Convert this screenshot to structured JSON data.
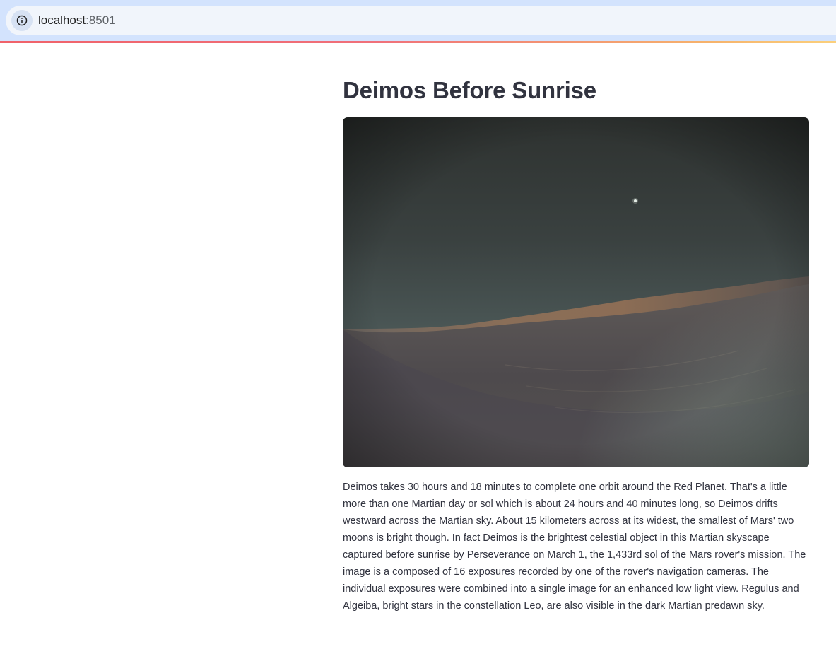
{
  "browser": {
    "url_host": "localhost",
    "url_port": ":8501"
  },
  "page": {
    "title": "Deimos Before Sunrise",
    "caption": "Deimos takes 30 hours and 18 minutes to complete one orbit around the Red Planet. That's a little more than one Martian day or sol which is about 24 hours and 40 minutes long, so Deimos drifts westward across the Martian sky. About 15 kilometers across at its widest, the smallest of Mars' two moons is bright though. In fact Deimos is the brightest celestial object in this Martian skyscape captured before sunrise by Perseverance on March 1, the 1,433rd sol of the Mars rover's mission. The image is a composed of 16 exposures recorded by one of the rover's navigation cameras. The individual exposures were combined into a single image for an enhanced low light view. Regulus and Algeiba, bright stars in the constellation Leo, are also visible in the dark Martian predawn sky."
  },
  "icons": {
    "site_info": "info-icon"
  },
  "colors": {
    "text": "#31333f",
    "browser_chrome": "#d3e3fd"
  }
}
